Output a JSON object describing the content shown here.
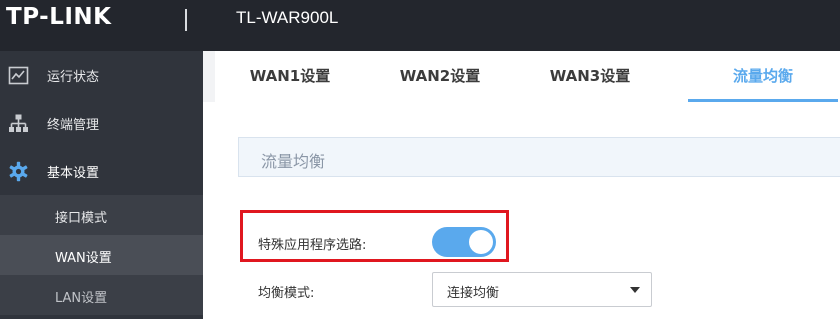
{
  "header": {
    "logo": "TP-LINK",
    "model": "TL-WAR900L"
  },
  "sidebar": {
    "items": [
      {
        "label": "运行状态",
        "icon": "status-chart-icon"
      },
      {
        "label": "终端管理",
        "icon": "network-topology-icon"
      },
      {
        "label": "基本设置",
        "icon": "gear-icon"
      }
    ],
    "subitems": [
      {
        "label": "接口模式"
      },
      {
        "label": "WAN设置"
      },
      {
        "label": "LAN设置"
      }
    ]
  },
  "tabs": [
    {
      "label": "WAN1设置"
    },
    {
      "label": "WAN2设置"
    },
    {
      "label": "WAN3设置"
    },
    {
      "label": "流量均衡"
    }
  ],
  "section": {
    "title": "流量均衡"
  },
  "form": {
    "special_routing_label": "特殊应用程序选路:",
    "special_routing_enabled": true,
    "balance_mode_label": "均衡模式:",
    "balance_mode_value": "连接均衡"
  },
  "colors": {
    "accent": "#5aa9ed",
    "highlight": "#e0171f",
    "topbar": "#23262d",
    "sidebar": "#30343c"
  }
}
